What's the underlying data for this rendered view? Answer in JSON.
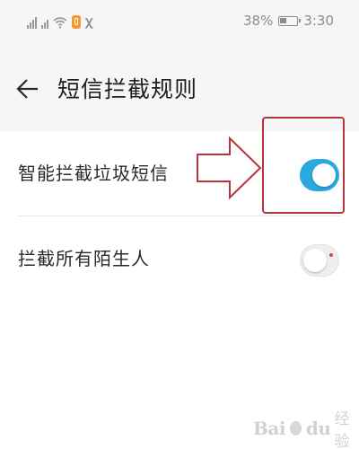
{
  "status_bar": {
    "battery_percent": "38%",
    "time": "3:30",
    "icons": [
      "signal-icon",
      "wifi-icon",
      "app-notification-icon",
      "notification-icon",
      "battery-icon"
    ]
  },
  "header": {
    "title": "短信拦截规则",
    "back_icon": "back-arrow-icon"
  },
  "settings": [
    {
      "label": "智能拦截垃圾短信",
      "toggle_on": true
    },
    {
      "label": "拦截所有陌生人",
      "toggle_on": false
    }
  ],
  "colors": {
    "toggle_on": "#2aa8e0",
    "toggle_off": "#eeeeee",
    "annotation": "#b9333c",
    "header_bg": "#f6f5f8"
  },
  "watermark": {
    "brand": "Bai",
    "brand_suffix": "du",
    "text": "经验"
  }
}
